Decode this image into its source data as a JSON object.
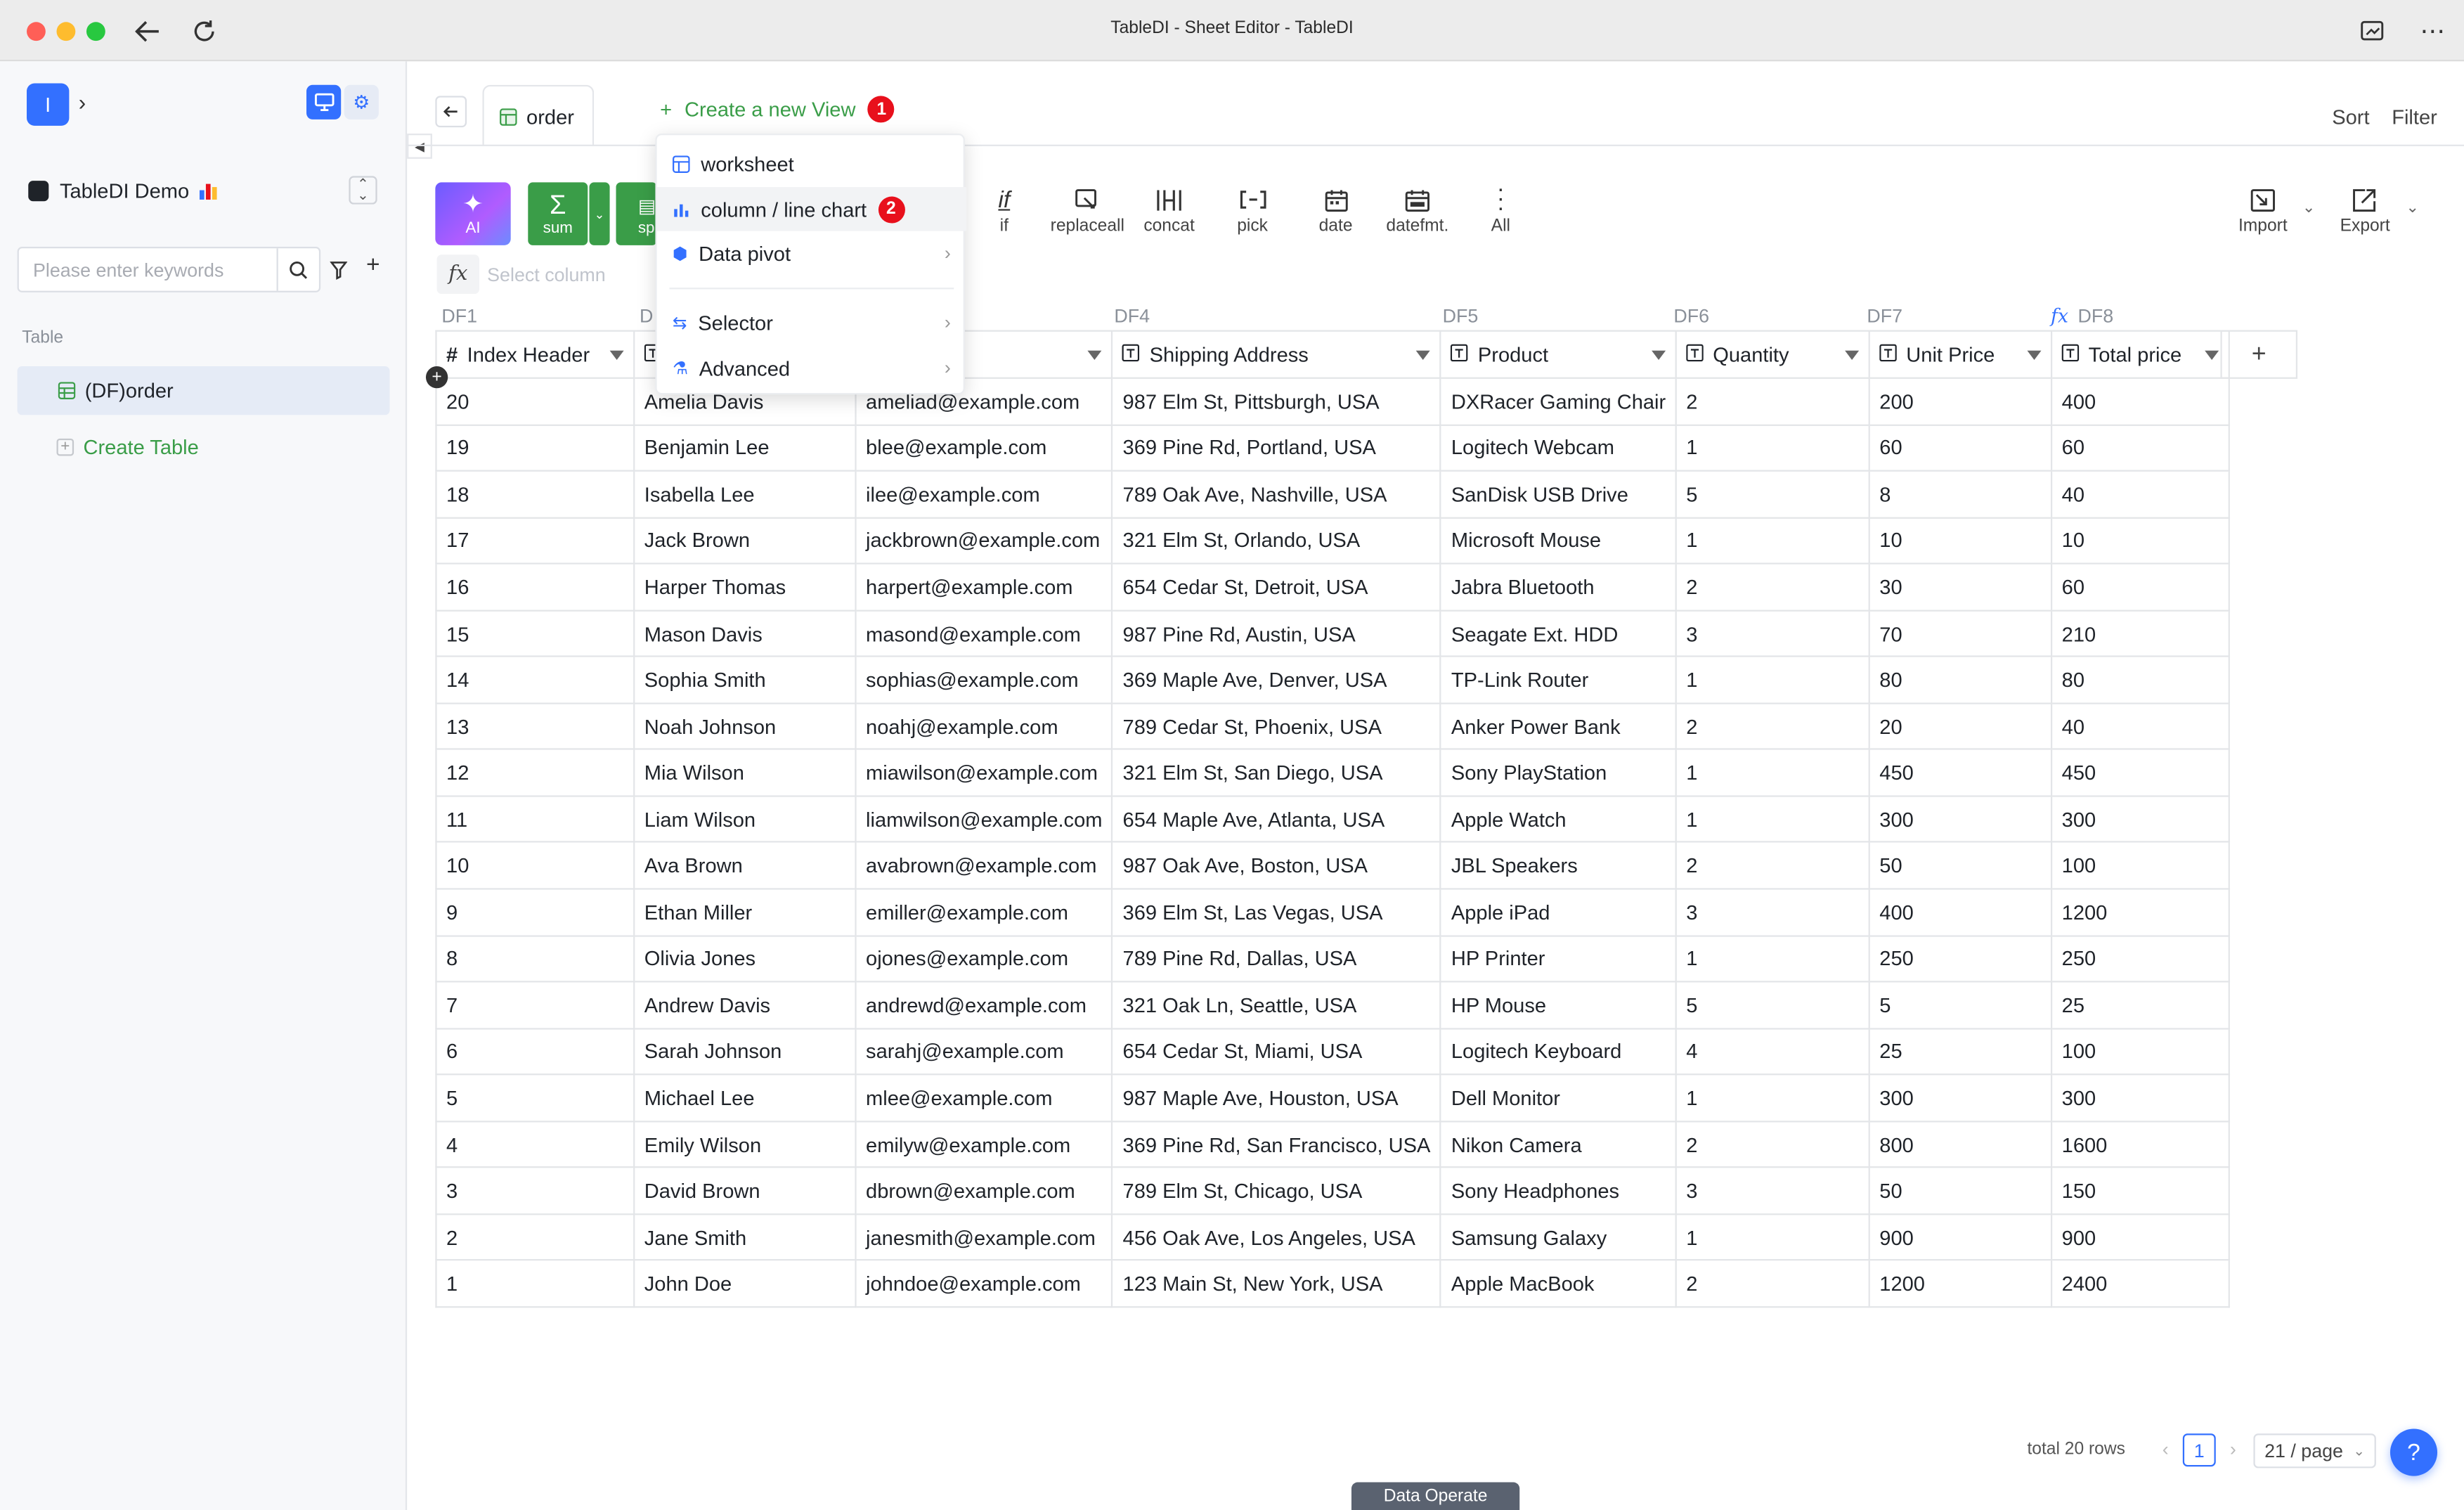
{
  "window": {
    "title": "TableDI - Sheet Editor - TableDI"
  },
  "sidebar": {
    "avatar_letter": "I",
    "workspace": "TableDI Demo",
    "search": {
      "placeholder": "Please enter keywords"
    },
    "section_label": "Table",
    "tables": [
      {
        "label": "(DF)order"
      }
    ],
    "create_table": "Create Table"
  },
  "tab": {
    "label": "order"
  },
  "create_view": {
    "label": "Create a new View",
    "badge": "1"
  },
  "menu": {
    "items": [
      {
        "label": "worksheet"
      },
      {
        "label": "column / line chart",
        "badge": "2"
      },
      {
        "label": "Data pivot"
      },
      {
        "label": "Selector"
      },
      {
        "label": "Advanced"
      }
    ]
  },
  "header_actions": {
    "sort": "Sort",
    "filter": "Filter"
  },
  "toolbar": {
    "ai": "AI",
    "sum": "sum",
    "sp": "sp",
    "tools": [
      "if",
      "replaceall",
      "concat",
      "pick",
      "date",
      "datefmt.",
      "All"
    ],
    "import": "Import",
    "export": "Export"
  },
  "formula": {
    "placeholder": "Select column"
  },
  "df_labels": [
    "DF1",
    "D",
    "DF4",
    "DF5",
    "DF6",
    "DF7",
    "DF8"
  ],
  "columns": [
    "Index Header",
    "",
    "",
    "Shipping Address",
    "Product",
    "Quantity",
    "Unit Price",
    "Total price"
  ],
  "rows": [
    [
      "20",
      "Amelia Davis",
      "ameliad@example.com",
      "987 Elm St, Pittsburgh, USA",
      "DXRacer Gaming Chair",
      "2",
      "200",
      "400"
    ],
    [
      "19",
      "Benjamin Lee",
      "blee@example.com",
      "369 Pine Rd, Portland, USA",
      "Logitech Webcam",
      "1",
      "60",
      "60"
    ],
    [
      "18",
      "Isabella Lee",
      "ilee@example.com",
      "789 Oak Ave, Nashville, USA",
      "SanDisk USB Drive",
      "5",
      "8",
      "40"
    ],
    [
      "17",
      "Jack Brown",
      "jackbrown@example.com",
      "321 Elm St, Orlando, USA",
      "Microsoft Mouse",
      "1",
      "10",
      "10"
    ],
    [
      "16",
      "Harper Thomas",
      "harpert@example.com",
      "654 Cedar St, Detroit, USA",
      "Jabra Bluetooth",
      "2",
      "30",
      "60"
    ],
    [
      "15",
      "Mason Davis",
      "masond@example.com",
      "987 Pine Rd, Austin, USA",
      "Seagate Ext. HDD",
      "3",
      "70",
      "210"
    ],
    [
      "14",
      "Sophia Smith",
      "sophias@example.com",
      "369 Maple Ave, Denver, USA",
      "TP-Link Router",
      "1",
      "80",
      "80"
    ],
    [
      "13",
      "Noah Johnson",
      "noahj@example.com",
      "789 Cedar St, Phoenix, USA",
      "Anker Power Bank",
      "2",
      "20",
      "40"
    ],
    [
      "12",
      "Mia Wilson",
      "miawilson@example.com",
      "321 Elm St, San Diego, USA",
      "Sony PlayStation",
      "1",
      "450",
      "450"
    ],
    [
      "11",
      "Liam Wilson",
      "liamwilson@example.com",
      "654 Maple Ave, Atlanta, USA",
      "Apple Watch",
      "1",
      "300",
      "300"
    ],
    [
      "10",
      "Ava Brown",
      "avabrown@example.com",
      "987 Oak Ave, Boston, USA",
      "JBL Speakers",
      "2",
      "50",
      "100"
    ],
    [
      "9",
      "Ethan Miller",
      "emiller@example.com",
      "369 Elm St, Las Vegas, USA",
      "Apple iPad",
      "3",
      "400",
      "1200"
    ],
    [
      "8",
      "Olivia Jones",
      "ojones@example.com",
      "789 Pine Rd, Dallas, USA",
      "HP Printer",
      "1",
      "250",
      "250"
    ],
    [
      "7",
      "Andrew Davis",
      "andrewd@example.com",
      "321 Oak Ln, Seattle, USA",
      "HP Mouse",
      "5",
      "5",
      "25"
    ],
    [
      "6",
      "Sarah Johnson",
      "sarahj@example.com",
      "654 Cedar St, Miami, USA",
      "Logitech Keyboard",
      "4",
      "25",
      "100"
    ],
    [
      "5",
      "Michael Lee",
      "mlee@example.com",
      "987 Maple Ave, Houston, USA",
      "Dell Monitor",
      "1",
      "300",
      "300"
    ],
    [
      "4",
      "Emily Wilson",
      "emilyw@example.com",
      "369 Pine Rd, San Francisco, USA",
      "Nikon Camera",
      "2",
      "800",
      "1600"
    ],
    [
      "3",
      "David Brown",
      "dbrown@example.com",
      "789 Elm St, Chicago, USA",
      "Sony Headphones",
      "3",
      "50",
      "150"
    ],
    [
      "2",
      "Jane Smith",
      "janesmith@example.com",
      "456 Oak Ave, Los Angeles, USA",
      "Samsung Galaxy",
      "1",
      "900",
      "900"
    ],
    [
      "1",
      "John Doe",
      "johndoe@example.com",
      "123 Main St, New York, USA",
      "Apple MacBook",
      "2",
      "1200",
      "2400"
    ]
  ],
  "footer": {
    "total": "total 20 rows",
    "page": "1",
    "per_page": "21 / page",
    "data_operate": "Data Operate",
    "help": "?"
  },
  "colors": {
    "green": "#3a9d48",
    "accent_blue": "#3370ff",
    "badge_red": "#e8101c"
  }
}
